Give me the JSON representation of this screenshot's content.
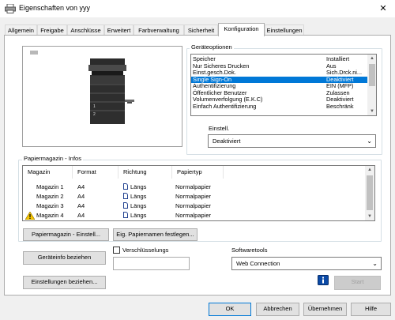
{
  "window": {
    "title": "Eigenschaften von yyy",
    "close": "✕"
  },
  "tabs": [
    {
      "label": "Allgemein"
    },
    {
      "label": "Freigabe"
    },
    {
      "label": "Anschlüsse"
    },
    {
      "label": "Erweitert"
    },
    {
      "label": "Farbverwaltung"
    },
    {
      "label": "Sicherheit"
    },
    {
      "label": "Konfiguration",
      "active": true
    },
    {
      "label": "Einstellungen"
    }
  ],
  "device_options": {
    "group_title": "Geräteoptionen",
    "rows": [
      {
        "name": "Speicher",
        "value": "Installiert"
      },
      {
        "name": "Nur Sicheres Drucken",
        "value": "Aus"
      },
      {
        "name": "Einst.gesch.Dok.",
        "value": "Sich.Drck.ni..."
      },
      {
        "name": "Single Sign-On",
        "value": "Deaktiviert",
        "selected": true
      },
      {
        "name": "Authentifizierung",
        "value": "EIN (MFP)"
      },
      {
        "name": "Öffentlicher Benutzer",
        "value": "Zulassen"
      },
      {
        "name": "Volumenverfolgung (E.K.C)",
        "value": "Deaktiviert"
      },
      {
        "name": "Einfach Authentifizierung",
        "value": "Beschränk"
      }
    ],
    "setting_label": "Einstell.",
    "setting_value": "Deaktiviert"
  },
  "paper_tray": {
    "group_title": "Papiermagazin - Infos",
    "columns": [
      "Magazin",
      "Format",
      "Richtung",
      "Papiertyp"
    ],
    "rows": [
      {
        "tray": "Magazin 1",
        "format": "A4",
        "direction": "Längs",
        "type": "Normalpapier",
        "warning": false
      },
      {
        "tray": "Magazin 2",
        "format": "A4",
        "direction": "Längs",
        "type": "Normalpapier",
        "warning": false
      },
      {
        "tray": "Magazin 3",
        "format": "A4",
        "direction": "Längs",
        "type": "Normalpapier",
        "warning": false
      },
      {
        "tray": "Magazin 4",
        "format": "A4",
        "direction": "Längs",
        "type": "Normalpapier",
        "warning": true
      }
    ],
    "settings_button": "Papiermagazin - Einstell...",
    "names_button": "Eig. Papiernamen festlegen..."
  },
  "device_info_button": "Geräteinfo beziehen",
  "encryption": {
    "label": "Verschlüsselungs",
    "checked": false,
    "value": ""
  },
  "settings_button": "Einstellungen beziehen...",
  "software_tools": {
    "label": "Softwaretools",
    "value": "Web Connection",
    "start_button": "Start"
  },
  "footer": {
    "ok": "OK",
    "cancel": "Abbrechen",
    "apply": "Übernehmen",
    "help": "Hilfe"
  },
  "colors": {
    "selection": "#0078d7",
    "warning": "#f5c400",
    "info": "#0b4aa6"
  }
}
